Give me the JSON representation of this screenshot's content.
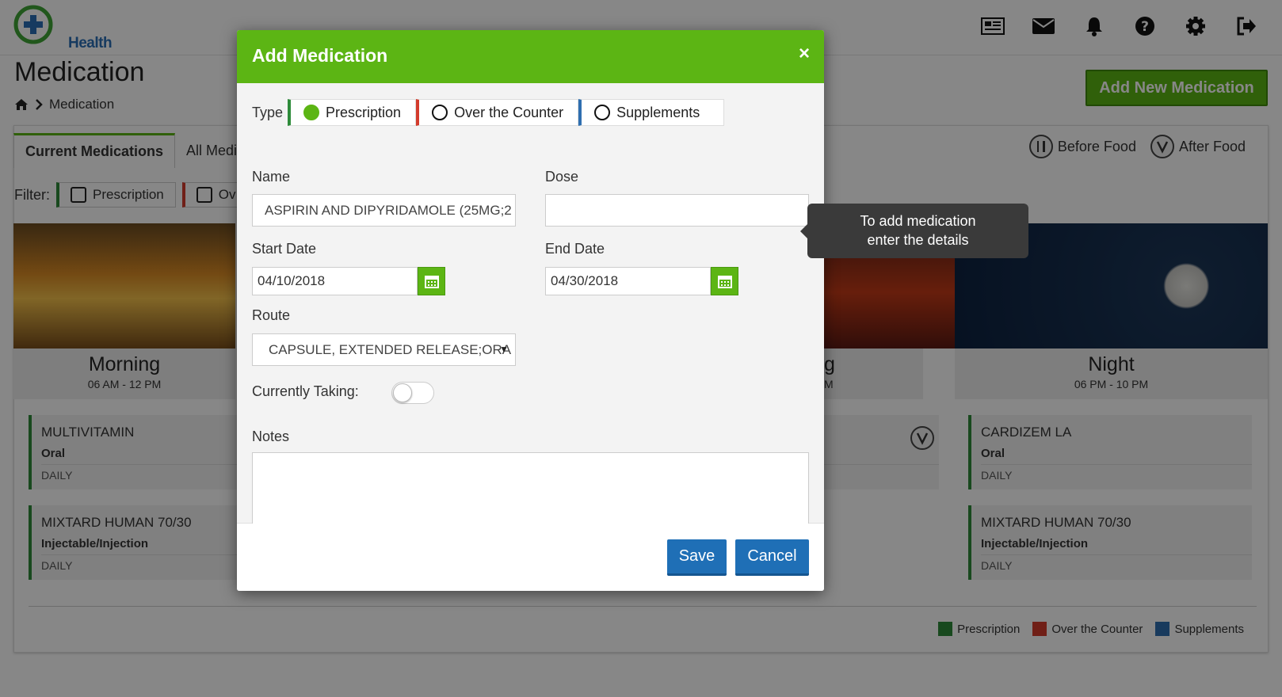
{
  "app": {
    "logo_text": "Health",
    "top_icons": [
      "news-icon",
      "mail-icon",
      "bell-icon",
      "help-icon",
      "gear-icon",
      "logout-icon"
    ]
  },
  "page": {
    "title": "Medication",
    "breadcrumb_current": "Medication",
    "add_new_label": "Add New Medication"
  },
  "tabs": [
    "Current Medications",
    "All Medi"
  ],
  "food_legend": {
    "before": "Before Food",
    "after": "After Food"
  },
  "filter": {
    "label": "Filter:",
    "options": [
      "Prescription",
      "Ov"
    ]
  },
  "slots": {
    "morning": {
      "title": "Morning",
      "time": "06 AM - 12 PM"
    },
    "evening_partial": {
      "title": "g",
      "time": "M"
    },
    "night": {
      "title": "Night",
      "time": "06 PM - 10 PM"
    }
  },
  "cards": {
    "morning": [
      {
        "name": "MULTIVITAMIN",
        "route": "Oral",
        "freq": "DAILY"
      },
      {
        "name": "MIXTARD HUMAN 70/30",
        "route": "Injectable/Injection",
        "freq": "DAILY"
      }
    ],
    "night": [
      {
        "name": "CARDIZEM LA",
        "route": "Oral",
        "freq": "DAILY"
      },
      {
        "name": "MIXTARD HUMAN 70/30",
        "route": "Injectable/Injection",
        "freq": "DAILY"
      }
    ]
  },
  "bottom_legend": [
    "Prescription",
    "Over the Counter",
    "Supplements"
  ],
  "colors": {
    "prescription": "#2e8b3a",
    "otc": "#d33b2c",
    "supplements": "#2f6fb0",
    "primary_green": "#5cb514",
    "primary_blue": "#1f6fb6"
  },
  "modal": {
    "title": "Add Medication",
    "close_glyph": "×",
    "type_label": "Type",
    "types": [
      "Prescription",
      "Over the Counter",
      "Supplements"
    ],
    "selected_type": "Prescription",
    "name_label": "Name",
    "name_value": "ASPIRIN AND DIPYRIDAMOLE (25MG;2",
    "dose_label": "Dose",
    "dose_value": "",
    "start_label": "Start Date",
    "start_value": "04/10/2018",
    "end_label": "End Date",
    "end_value": "04/30/2018",
    "route_label": "Route",
    "route_value": "CAPSULE, EXTENDED RELEASE;ORA",
    "taking_label": "Currently Taking:",
    "taking_on": false,
    "notes_label": "Notes",
    "notes_value": "",
    "save_label": "Save",
    "cancel_label": "Cancel"
  },
  "tooltip": {
    "line1": "To add medication",
    "line2": "enter the details"
  }
}
